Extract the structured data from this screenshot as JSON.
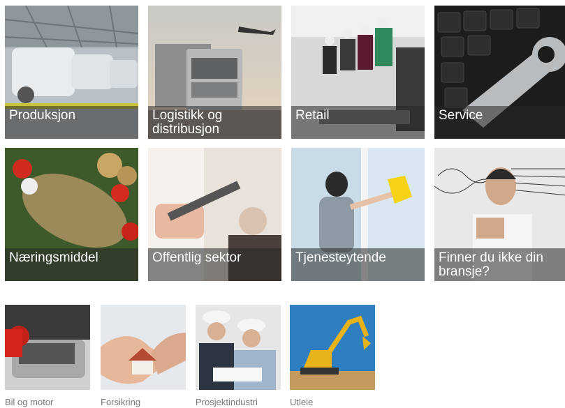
{
  "tiles": [
    {
      "label": "Produksjon"
    },
    {
      "label": "Logistikk og distribusjon"
    },
    {
      "label": "Retail"
    },
    {
      "label": "Service"
    },
    {
      "label": "Næringsmiddel"
    },
    {
      "label": "Offentlig sektor"
    },
    {
      "label": "Tjenesteytende"
    },
    {
      "label": "Finner du ikke din bransje?"
    }
  ],
  "small_tiles": [
    {
      "label": "Bil og motor"
    },
    {
      "label": "Forsikring"
    },
    {
      "label": "Prosjektindustri"
    },
    {
      "label": "Utleie"
    }
  ]
}
